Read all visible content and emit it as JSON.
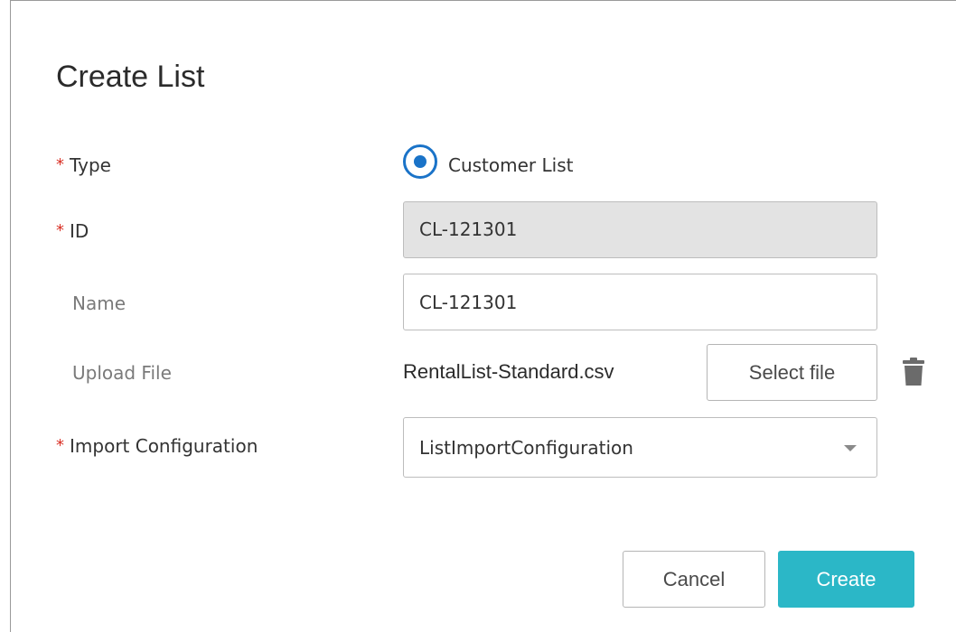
{
  "dialog": {
    "title": "Create List"
  },
  "form": {
    "required_mark": "*",
    "type": {
      "label": "Type",
      "required": true,
      "option_label": "Customer List",
      "selected": true
    },
    "id": {
      "label": "ID",
      "required": true,
      "value": "CL-121301",
      "readonly": true
    },
    "name": {
      "label": "Name",
      "required": false,
      "value": "CL-121301"
    },
    "upload": {
      "label": "Upload File",
      "required": false,
      "file_name": "RentalList-Standard.csv",
      "select_label": "Select file",
      "delete_icon": "trash-icon"
    },
    "import_config": {
      "label": "Import Configuration",
      "required": true,
      "selected_value": "ListImportConfiguration",
      "dropdown_icon": "caret-down-icon"
    }
  },
  "actions": {
    "cancel_label": "Cancel",
    "create_label": "Create"
  },
  "colors": {
    "accent": "#2bb7c7",
    "radio": "#1a73c8",
    "required": "#d93025",
    "readonly_bg": "#e3e3e3"
  }
}
